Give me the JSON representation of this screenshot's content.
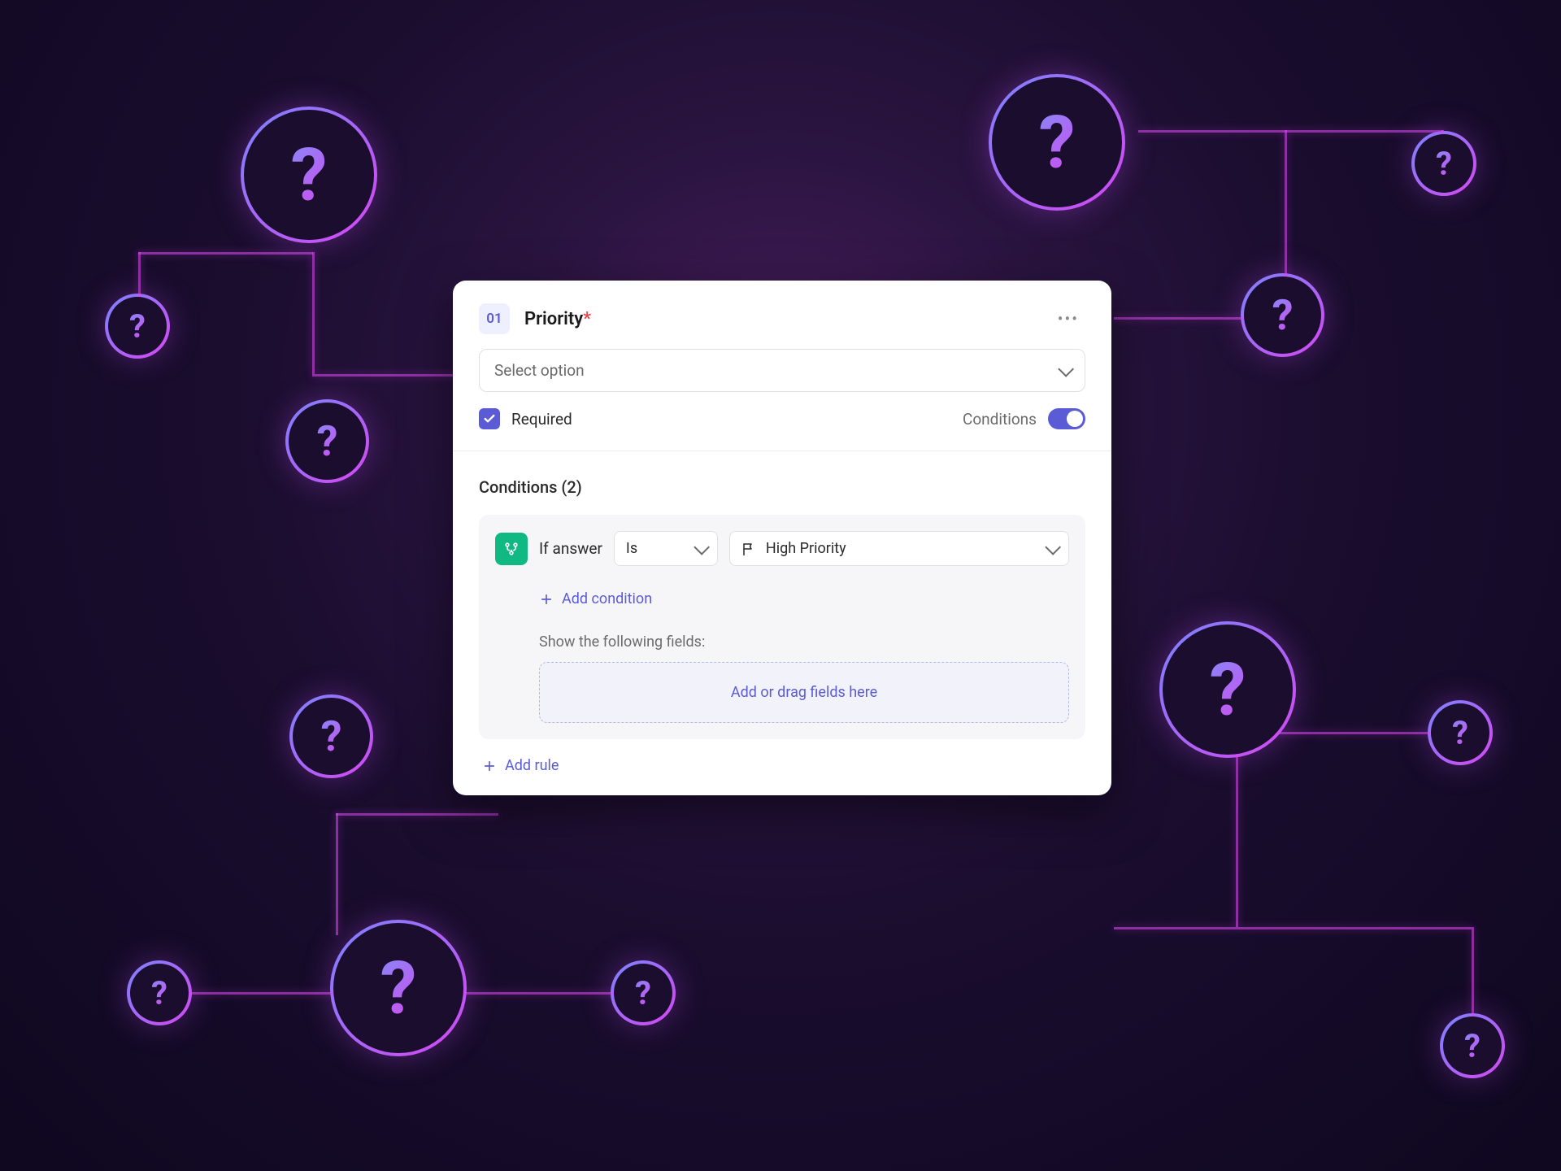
{
  "card": {
    "number": "01",
    "title": "Priority",
    "select_placeholder": "Select option",
    "required_label": "Required",
    "conditions_toggle_label": "Conditions",
    "conditions_title": "Conditions (2)",
    "rule": {
      "if_answer_label": "If answer",
      "operator": "Is",
      "value": "High Priority",
      "add_condition_label": "Add condition",
      "show_fields_label": "Show the following fields:",
      "drop_zone_label": "Add or drag fields here"
    },
    "add_rule_label": "Add rule"
  }
}
